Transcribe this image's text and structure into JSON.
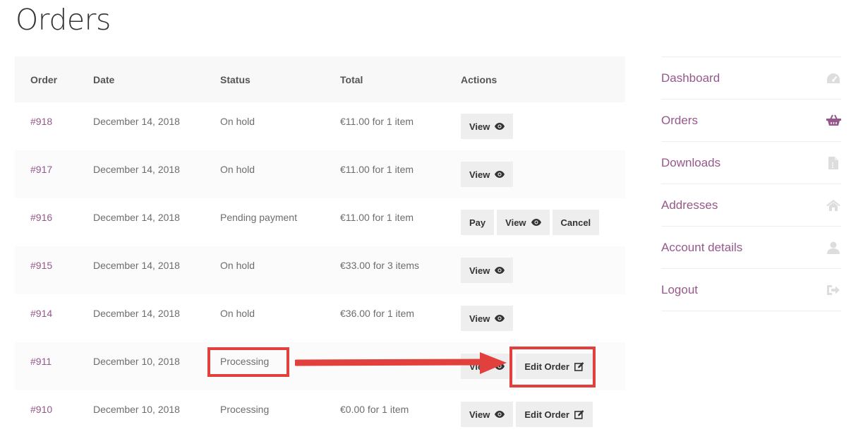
{
  "page": {
    "title": "Orders"
  },
  "table": {
    "headers": {
      "order": "Order",
      "date": "Date",
      "status": "Status",
      "total": "Total",
      "actions": "Actions"
    },
    "rows": [
      {
        "number": "#918",
        "date": "December 14, 2018",
        "status": "On hold",
        "total": "€11.00 for 1 item"
      },
      {
        "number": "#917",
        "date": "December 14, 2018",
        "status": "On hold",
        "total": "€11.00 for 1 item"
      },
      {
        "number": "#916",
        "date": "December 14, 2018",
        "status": "Pending payment",
        "total": "€11.00 for 1 item"
      },
      {
        "number": "#915",
        "date": "December 14, 2018",
        "status": "On hold",
        "total": "€33.00 for 3 items"
      },
      {
        "number": "#914",
        "date": "December 14, 2018",
        "status": "On hold",
        "total": "€36.00 for 1 item"
      },
      {
        "number": "#911",
        "date": "December 10, 2018",
        "status": "Processing",
        "total": ""
      },
      {
        "number": "#910",
        "date": "December 10, 2018",
        "status": "Processing",
        "total": "€0.00 for 1 item"
      }
    ]
  },
  "buttons": {
    "view": "View",
    "pay": "Pay",
    "cancel": "Cancel",
    "edit_order": "Edit Order"
  },
  "icons": {
    "view": "eye-icon",
    "edit": "edit-icon",
    "dashboard": "dashboard-icon",
    "orders": "basket-icon",
    "downloads": "file-icon",
    "addresses": "home-icon",
    "account": "user-icon",
    "logout": "logout-icon"
  },
  "nav": {
    "items": [
      {
        "label": "Dashboard"
      },
      {
        "label": "Orders"
      },
      {
        "label": "Downloads"
      },
      {
        "label": "Addresses"
      },
      {
        "label": "Account details"
      },
      {
        "label": "Logout"
      }
    ]
  },
  "colors": {
    "link": "#96588a",
    "annotation": "#e2403d",
    "button_bg": "#eeeeee",
    "icon_muted": "#dddddd"
  }
}
